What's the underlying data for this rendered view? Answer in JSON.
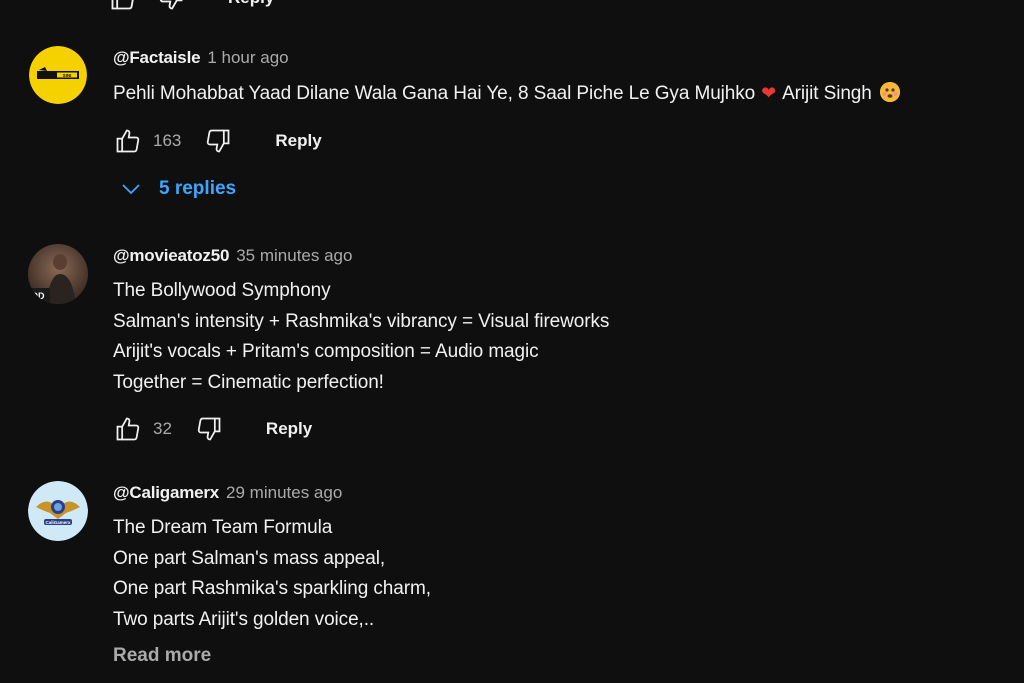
{
  "top_partial": {
    "reply_label": "Reply"
  },
  "comments": [
    {
      "author": "@Factaisle",
      "time": "1 hour ago",
      "text_parts": {
        "before_heart": "Pehli Mohabbat Yaad Dilane Wala Gana Hai Ye, 8 Saal Piche Le Gya Mujhko",
        "heart": "❤",
        "after_heart": "Arijit Singh"
      },
      "likes": "163",
      "reply_label": "Reply",
      "replies_label": "5 replies",
      "avatar_icon": "factaisle-logo-avatar",
      "avatar_color": "#f5d100"
    },
    {
      "author": "@movieatoz50",
      "time": "35 minutes ago",
      "lines": [
        "The Bollywood Symphony",
        "Salman's intensity + Rashmika's vibrancy = Visual fireworks",
        "Arijit's vocals + Pritam's composition = Audio magic",
        "Together = Cinematic perfection!"
      ],
      "likes": "32",
      "reply_label": "Reply",
      "avatar_icon": "photo-avatar"
    },
    {
      "author": "@Caligamerx",
      "time": "29 minutes ago",
      "lines": [
        "The Dream Team Formula",
        "One part Salman's mass appeal,",
        "One part Rashmika's sparkling charm,",
        "Two parts Arijit's golden voice,.."
      ],
      "read_more_label": "Read more",
      "avatar_icon": "emblem-avatar",
      "avatar_color": "#cfe9f7"
    }
  ],
  "colors": {
    "background": "#0f0f0f",
    "text": "#f1f1f1",
    "secondary": "#aaaaaa",
    "link_blue": "#3ea6ff",
    "heart": "#e53935"
  }
}
